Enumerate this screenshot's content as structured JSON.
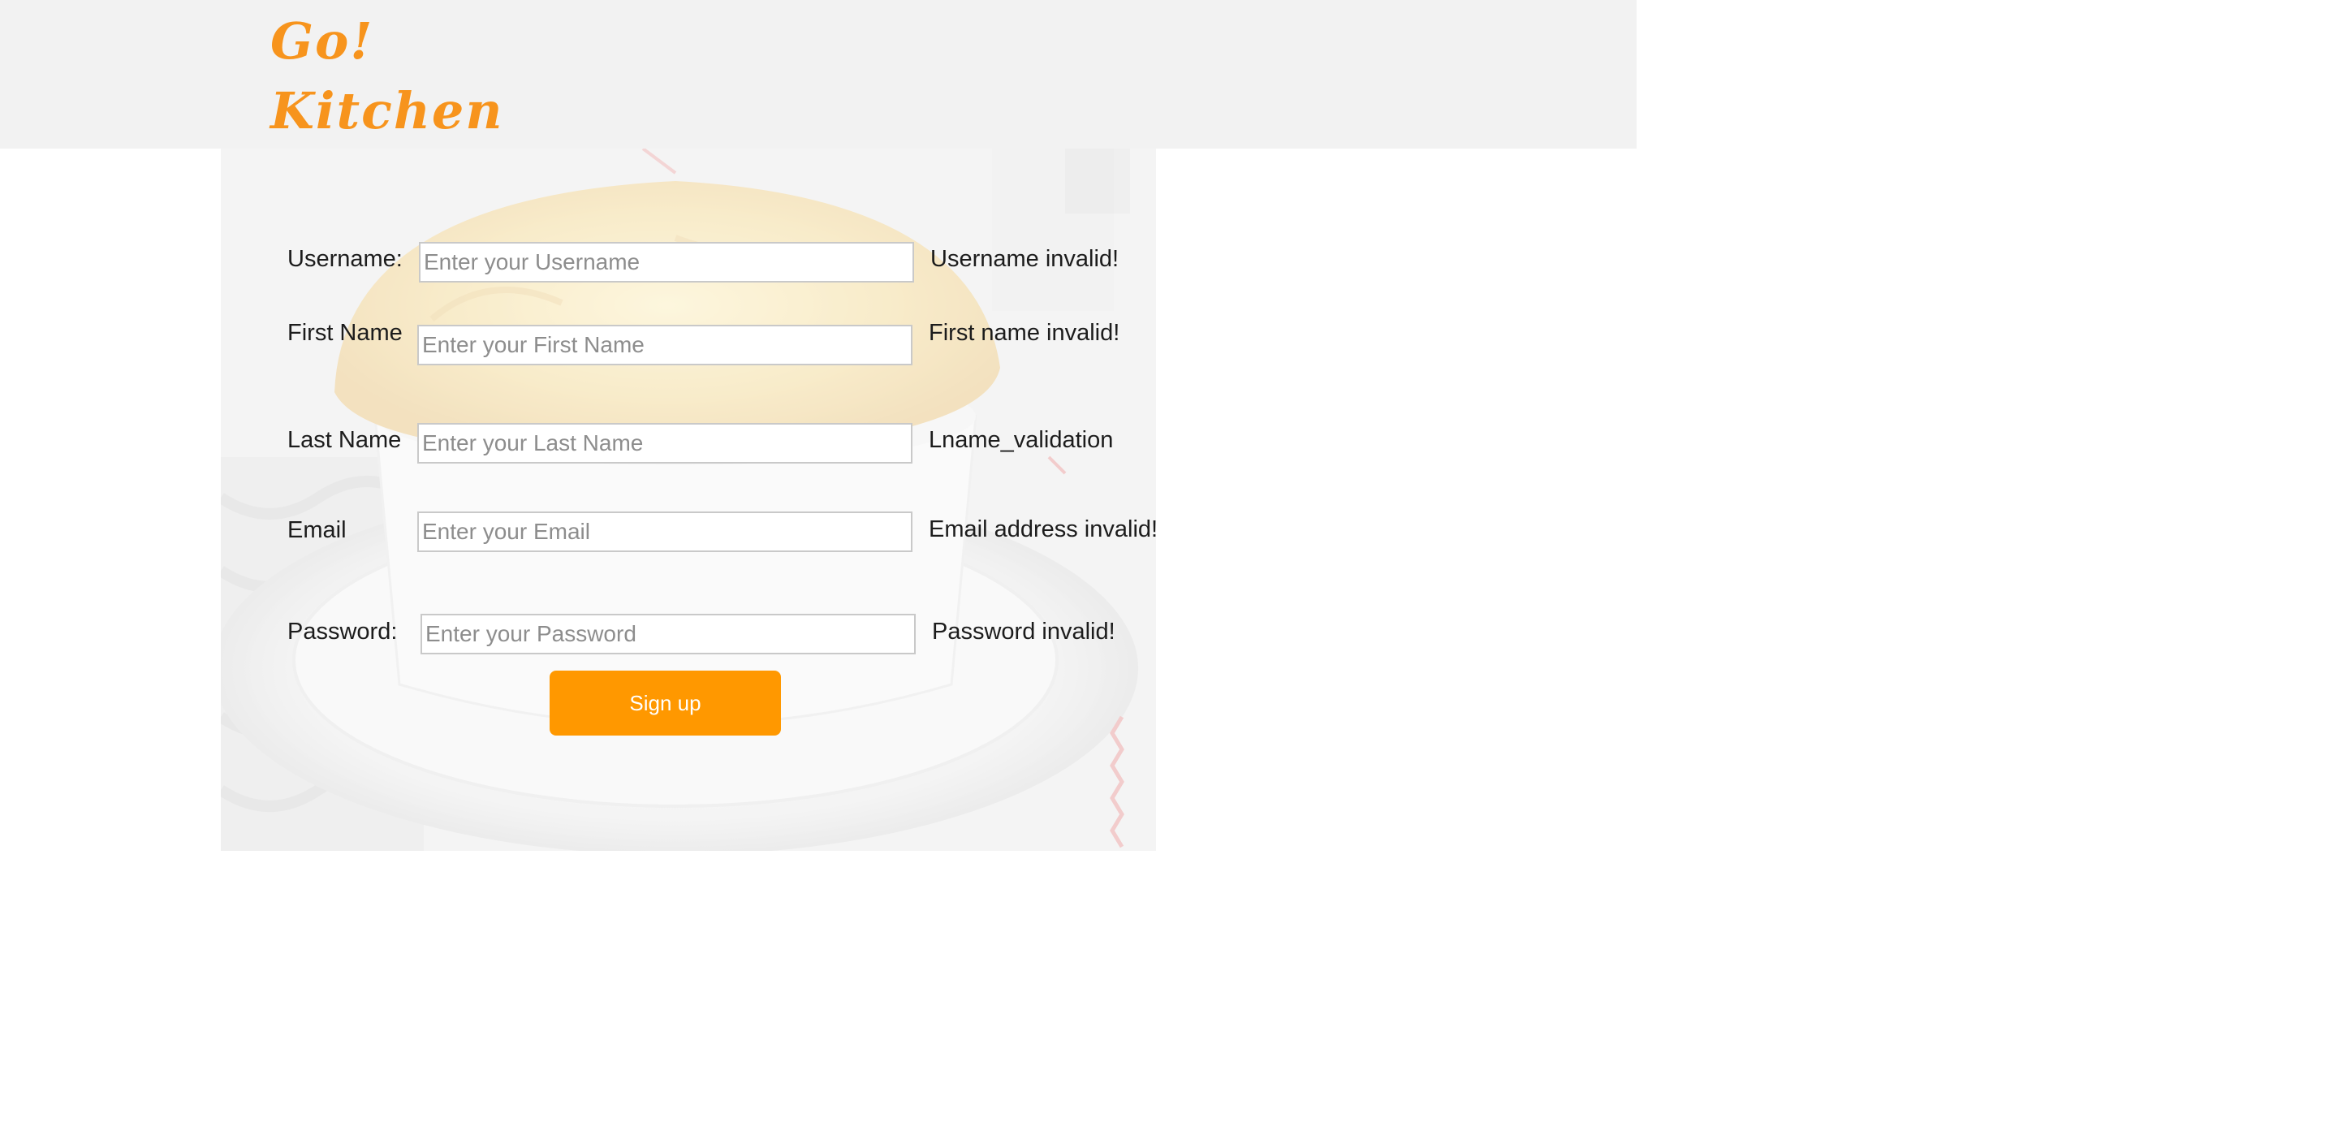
{
  "header": {
    "logo_line1": "Go!",
    "logo_line2": "Kitchen"
  },
  "form": {
    "username": {
      "label": "Username:",
      "placeholder": "Enter your Username",
      "message": "Username invalid!"
    },
    "first_name": {
      "label": "First Name",
      "placeholder": "Enter your First Name",
      "message": "First name invalid!"
    },
    "last_name": {
      "label": "Last Name",
      "placeholder": "Enter your Last Name",
      "message": "Lname_validation"
    },
    "email": {
      "label": "Email",
      "placeholder": "Enter your Email",
      "message": "Email address invalid!"
    },
    "password": {
      "label": "Password:",
      "placeholder": "Enter your Password",
      "message": "Password invalid!"
    },
    "submit_label": "Sign up"
  },
  "colors": {
    "brand_orange": "#f7941d",
    "button_orange": "#ff9800",
    "header_bg": "#f2f2f2"
  }
}
